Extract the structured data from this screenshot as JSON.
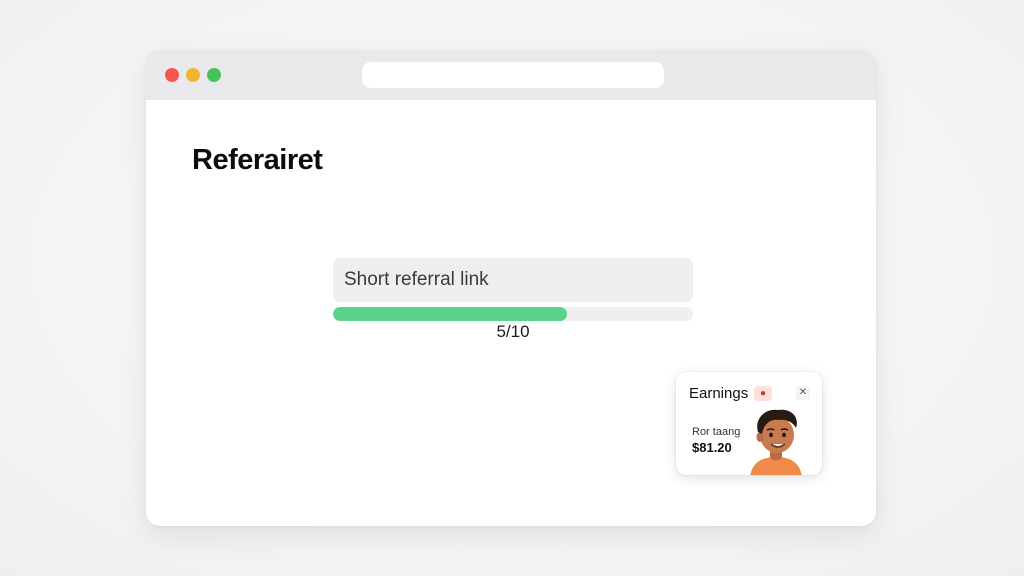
{
  "page": {
    "title": "Referairet"
  },
  "referral": {
    "link_placeholder": "Short referral link",
    "progress_value": 0.65,
    "progress_text": "5/10"
  },
  "earnings": {
    "title": "Earnings",
    "badge_icon": "coin-icon",
    "close_icon": "close-icon",
    "label": "Ror taang",
    "amount": "$81.20"
  },
  "colors": {
    "progress_fill": "#5ad38c",
    "dot_red": "#f2574d",
    "dot_yellow": "#f3b52f",
    "dot_green": "#46c35c"
  }
}
